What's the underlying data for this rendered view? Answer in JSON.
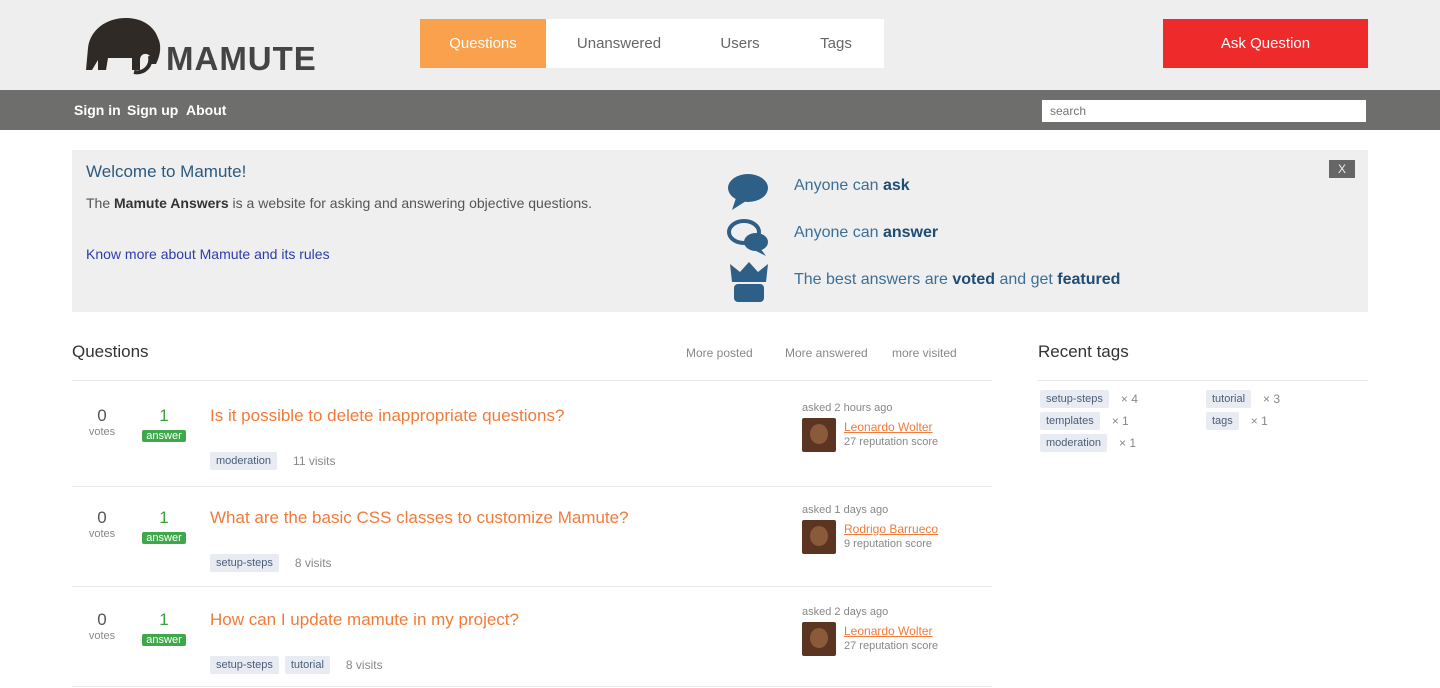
{
  "brand": {
    "logo_text": "MAMUTE"
  },
  "nav": {
    "tabs": [
      {
        "label": "Questions",
        "active": true
      },
      {
        "label": "Unanswered",
        "active": false
      },
      {
        "label": "Users",
        "active": false
      },
      {
        "label": "Tags",
        "active": false
      }
    ],
    "ask_label": "Ask Question"
  },
  "topbar": {
    "links": [
      "Sign in",
      "Sign up",
      "About"
    ],
    "search_placeholder": "search"
  },
  "welcome": {
    "title": "Welcome to Mamute!",
    "text_prefix": "The",
    "text_bold": "Mamute Answers",
    "text_suffix": "is a website for asking and answering objective questions.",
    "link": "Know more about Mamute and its rules",
    "close_label": "X",
    "features": [
      {
        "icon": "speech-bubble-icon",
        "prefix": "Anyone can",
        "bold": "ask",
        "suffix": ""
      },
      {
        "icon": "chat-bubbles-icon",
        "prefix": "Anyone can",
        "bold": "answer",
        "suffix": ""
      },
      {
        "icon": "voted-featured-icon",
        "prefix": "The best answers are",
        "bold": "voted",
        "mid": "and get",
        "bold2": "featured"
      }
    ]
  },
  "questions": {
    "title": "Questions",
    "filters": [
      "More posted",
      "More answered",
      "more visited"
    ],
    "items": [
      {
        "votes": "0",
        "votes_label": "votes",
        "answers": "1",
        "answers_label": "answer",
        "title": "Is it possible to delete inappropriate questions?",
        "tags": [
          "moderation"
        ],
        "views": "11 visits",
        "when": "asked 2 hours ago",
        "user": "Leonardo Wolter",
        "rep": "27 reputation score"
      },
      {
        "votes": "0",
        "votes_label": "votes",
        "answers": "1",
        "answers_label": "answer",
        "title": "What are the basic CSS classes to customize Mamute?",
        "tags": [
          "setup-steps"
        ],
        "views": "8 visits",
        "when": "asked 1 days ago",
        "user": "Rodrigo Barrueco",
        "rep": "9 reputation score"
      },
      {
        "votes": "0",
        "votes_label": "votes",
        "answers": "1",
        "answers_label": "answer",
        "title": "How can I update mamute in my project?",
        "tags": [
          "setup-steps",
          "tutorial"
        ],
        "views": "8 visits",
        "when": "asked 2 days ago",
        "user": "Leonardo Wolter",
        "rep": "27 reputation score"
      }
    ]
  },
  "recent_tags": {
    "title": "Recent tags",
    "items": [
      {
        "name": "setup-steps",
        "count": "× 4"
      },
      {
        "name": "tutorial",
        "count": "× 3"
      },
      {
        "name": "templates",
        "count": "× 1"
      },
      {
        "name": "tags",
        "count": "× 1"
      },
      {
        "name": "moderation",
        "count": "× 1"
      }
    ]
  }
}
